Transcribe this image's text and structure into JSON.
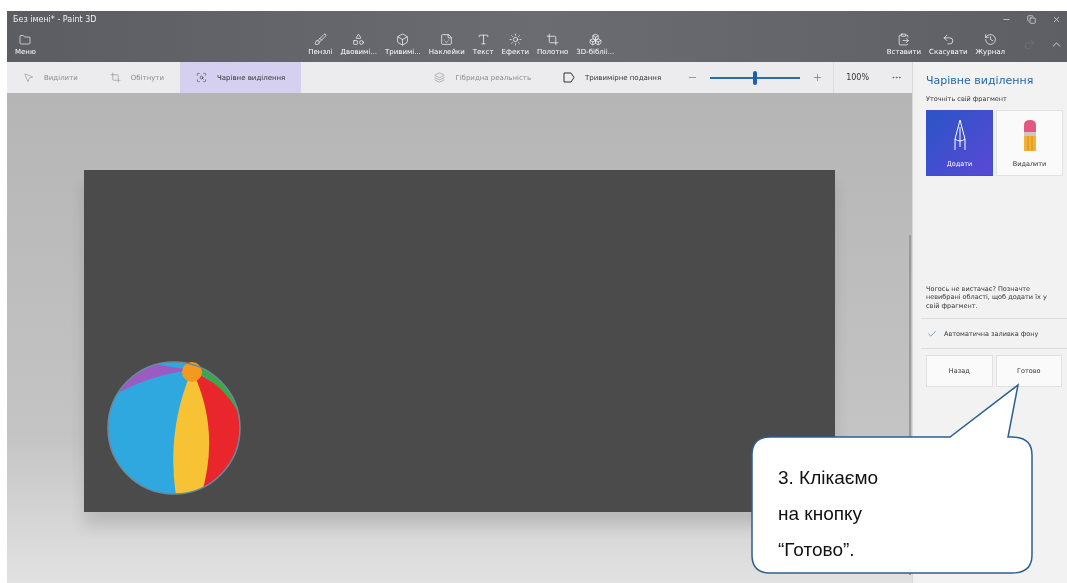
{
  "window": {
    "title": "Без імені* - Paint 3D"
  },
  "menu": {
    "label": "Меню"
  },
  "tools": [
    {
      "kind": "brush",
      "label": "Пензлі"
    },
    {
      "kind": "shapes2d",
      "label": "Двовимі..."
    },
    {
      "kind": "shapes3d",
      "label": "Тривимі..."
    },
    {
      "kind": "stickers",
      "label": "Наклейки"
    },
    {
      "kind": "text",
      "label": "Текст"
    },
    {
      "kind": "effects",
      "label": "Ефекти"
    },
    {
      "kind": "canvas",
      "label": "Полотно"
    },
    {
      "kind": "library",
      "label": "3D-бібліі..."
    }
  ],
  "actions": [
    {
      "kind": "paste",
      "label": "Вставити"
    },
    {
      "kind": "undo",
      "label": "Скасувати"
    },
    {
      "kind": "history",
      "label": "Журнал"
    }
  ],
  "selection_tools": [
    {
      "kind": "select",
      "label": "Виділити",
      "disabled": true,
      "selected": false
    },
    {
      "kind": "crop",
      "label": "Обітнути",
      "disabled": true,
      "selected": false
    },
    {
      "kind": "magic",
      "label": "Чарівне виділення",
      "disabled": false,
      "selected": true
    }
  ],
  "view_tools": [
    {
      "kind": "mixed",
      "label": "Гібридна реальність",
      "disabled": true
    },
    {
      "kind": "view3d",
      "label": "Тривимірне подання",
      "disabled": false
    }
  ],
  "zoom": {
    "level": 0.5,
    "reading": "100%"
  },
  "panel": {
    "title": "Чарівне виділення",
    "subtitle": "Уточніть свій фрагмент",
    "options": [
      {
        "kind": "add",
        "label": "Додати",
        "selected": true
      },
      {
        "kind": "remove",
        "label": "Видалити",
        "selected": false
      }
    ],
    "hint": "Чогось не вистачає? Позначте невибрані області, щоб додати їх у свій фрагмент.",
    "auto_fill": {
      "label": "Автоматична заливка фону",
      "checked": true
    },
    "buttons": [
      "Назад",
      "Готово"
    ]
  },
  "callout": {
    "lines": [
      "3. Клікаємо",
      "на кнопку",
      "“Готово”."
    ]
  }
}
